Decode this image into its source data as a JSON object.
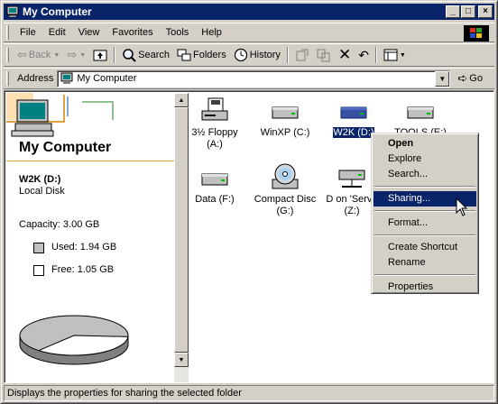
{
  "window": {
    "title": "My Computer"
  },
  "menubar": {
    "items": [
      "File",
      "Edit",
      "View",
      "Favorites",
      "Tools",
      "Help"
    ]
  },
  "toolbar": {
    "back": "Back",
    "search": "Search",
    "folders": "Folders",
    "history": "History"
  },
  "addressbar": {
    "label": "Address",
    "value": "My Computer",
    "go": "Go"
  },
  "leftpane": {
    "heading": "My Computer",
    "selected_name": "W2K (D:)",
    "selected_type": "Local Disk",
    "capacity": "Capacity: 3.00 GB",
    "used": "Used: 1.94 GB",
    "free": "Free: 1.05 GB",
    "used_fraction": 0.647
  },
  "drives": [
    {
      "label1": "3½ Floppy",
      "label2": "(A:)",
      "icon": "floppy-drive-icon"
    },
    {
      "label1": "WinXP (C:)",
      "label2": "",
      "icon": "hard-drive-icon"
    },
    {
      "label1": "W2K (D:)",
      "label2": "",
      "icon": "hard-drive-icon",
      "selected": true
    },
    {
      "label1": "TOOLS (E:)",
      "label2": "",
      "icon": "hard-drive-icon"
    },
    {
      "label1": "Data (F:)",
      "label2": "",
      "icon": "hard-drive-icon"
    },
    {
      "label1": "Compact Disc",
      "label2": "(G:)",
      "icon": "cd-drive-icon"
    },
    {
      "label1": "D on 'Serve",
      "label2": "(Z:)",
      "icon": "network-drive-icon"
    }
  ],
  "context_menu": {
    "items": [
      "Open",
      "Explore",
      "Search...",
      "Sharing...",
      "Format...",
      "Create Shortcut",
      "Rename",
      "Properties"
    ],
    "highlighted": "Sharing..."
  },
  "statusbar": {
    "text": "Displays the properties for sharing the selected folder"
  }
}
